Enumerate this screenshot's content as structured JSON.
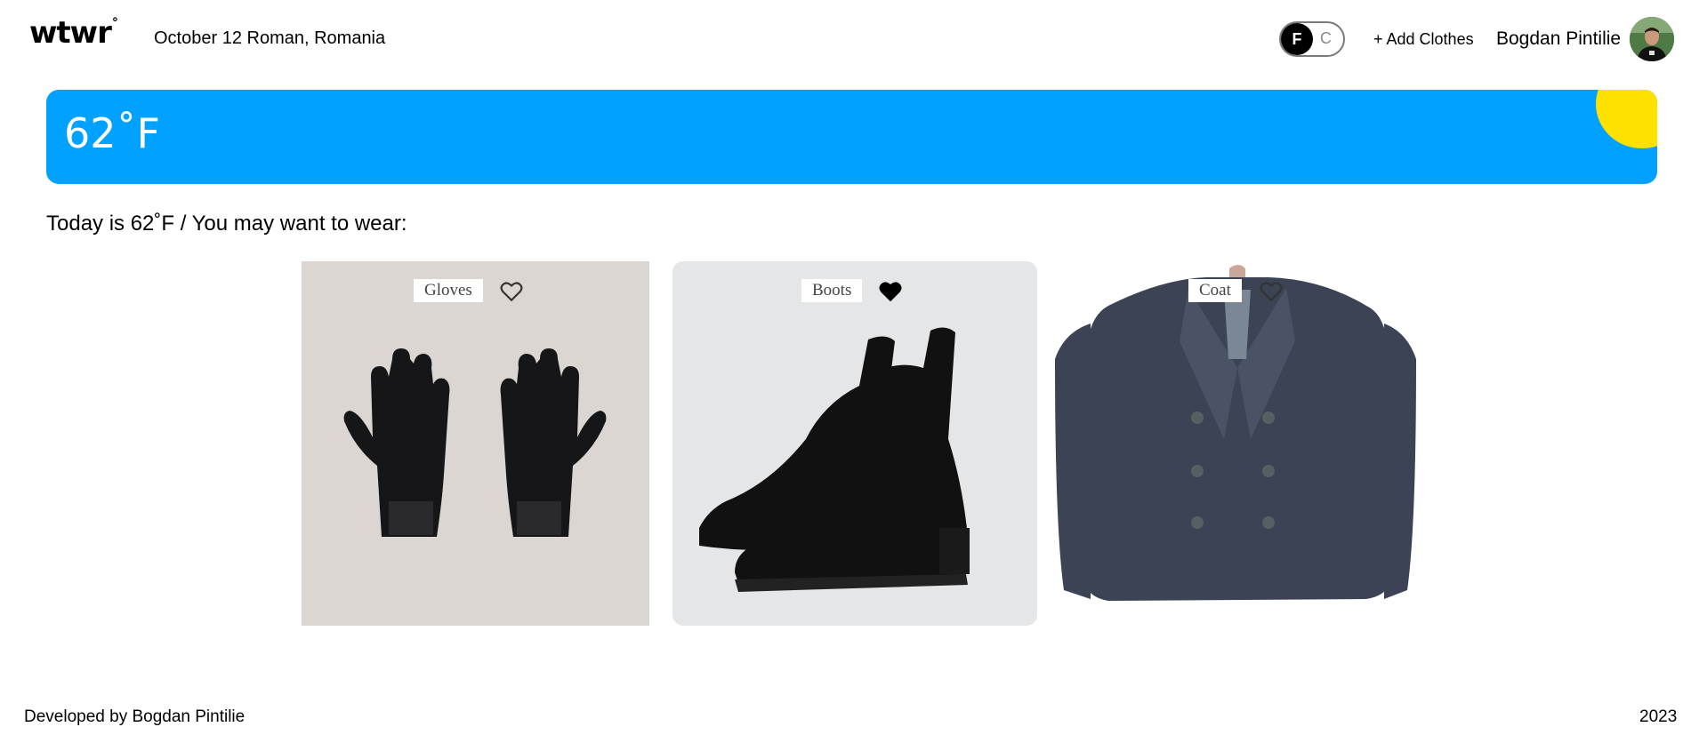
{
  "header": {
    "logo": "wtwr",
    "logo_mark": "°",
    "date_location": "October 12 Roman, Romania",
    "unit_toggle": {
      "active": "F",
      "inactive": "C"
    },
    "add_clothes_label": "+ Add Clothes",
    "user_name": "Bogdan Pintilie"
  },
  "weather": {
    "temperature": "62˚F",
    "sun_color": "#ffe100",
    "background_color": "#00a1ff"
  },
  "main": {
    "intro": "Today is 62˚F / You may want to wear:",
    "items": [
      {
        "name": "Gloves",
        "liked": false,
        "icon": "heart-outline-icon"
      },
      {
        "name": "Boots",
        "liked": true,
        "icon": "heart-filled-icon"
      },
      {
        "name": "Coat",
        "liked": false,
        "icon": "heart-outline-icon"
      }
    ]
  },
  "footer": {
    "credit": "Developed by Bogdan Pintilie",
    "year": "2023"
  }
}
